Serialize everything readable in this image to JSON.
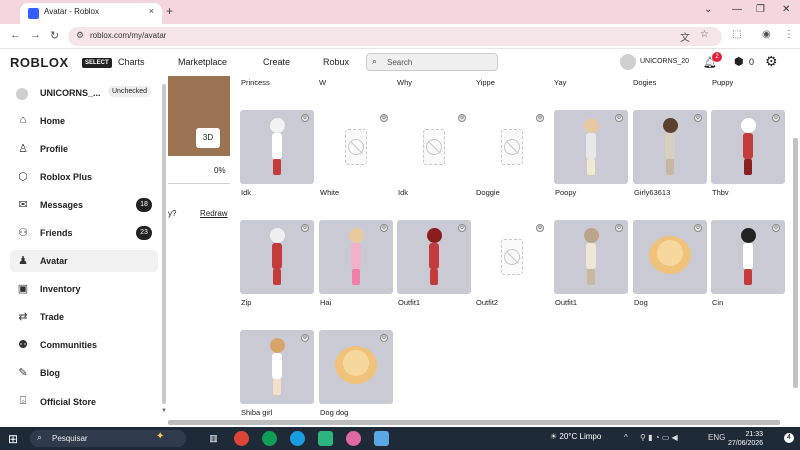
{
  "browser": {
    "tab_title": "Avatar - Roblox",
    "tab_close": "×",
    "new_tab": "+",
    "url": "roblox.com/my/avatar",
    "window_controls": [
      "⌄",
      "—",
      "❐",
      "✕"
    ]
  },
  "header": {
    "logo": "ROBLOX",
    "logo_badge": "SELECT",
    "nav": [
      "Charts",
      "Marketplace",
      "Create",
      "Robux"
    ],
    "search_placeholder": "Search",
    "username": "UNICORNS_20",
    "notification_count": "2",
    "robux_balance": "0"
  },
  "sidebar": {
    "username": "UNICORNS_...",
    "status_tag": "Unchecked",
    "items": [
      {
        "label": "Home",
        "icon": "home-icon",
        "glyph": "⌂"
      },
      {
        "label": "Profile",
        "icon": "profile-icon",
        "glyph": "♙"
      },
      {
        "label": "Roblox Plus",
        "icon": "roblox-plus-icon",
        "glyph": "⬡"
      },
      {
        "label": "Messages",
        "icon": "messages-icon",
        "glyph": "✉",
        "count": "18"
      },
      {
        "label": "Friends",
        "icon": "friends-icon",
        "glyph": "⚇",
        "count": "23"
      },
      {
        "label": "Avatar",
        "icon": "avatar-icon",
        "glyph": "♟",
        "active": true
      },
      {
        "label": "Inventory",
        "icon": "inventory-icon",
        "glyph": "▣"
      },
      {
        "label": "Trade",
        "icon": "trade-icon",
        "glyph": "⇄"
      },
      {
        "label": "Communities",
        "icon": "communities-icon",
        "glyph": "⚉"
      },
      {
        "label": "Blog",
        "icon": "blog-icon",
        "glyph": "✎"
      },
      {
        "label": "Official Store",
        "icon": "store-icon",
        "glyph": "⌺"
      }
    ]
  },
  "preview": {
    "view_3d": "3D",
    "progress_percent": "0%",
    "question_fragment": "y?",
    "redraw": "Redraw"
  },
  "outfits_top_row_labels": [
    "Princess",
    "W",
    "Why",
    "Yippe",
    "Yay",
    "Dogies",
    "Puppy"
  ],
  "outfits": [
    {
      "name": "Idk",
      "kind": "avatar",
      "hat": "#f2f2f2",
      "shirt": "#ffffff",
      "legs": "#c33b3b",
      "hair": "#2a2a2a"
    },
    {
      "name": "White",
      "kind": "empty"
    },
    {
      "name": "Idk",
      "kind": "empty"
    },
    {
      "name": "Doggie",
      "kind": "empty"
    },
    {
      "name": "Poopy",
      "kind": "avatar",
      "hat": "#e6c9a0",
      "shirt": "#e8e8e8",
      "legs": "#f3e8d0",
      "hair": "#d9b98c"
    },
    {
      "name": "Girly63613",
      "kind": "avatar",
      "hat": "#5a4030",
      "shirt": "#d8cfc0",
      "legs": "#c7b8a3",
      "hair": "#4a3020"
    },
    {
      "name": "Thbv",
      "kind": "avatar",
      "hat": "#ffffff",
      "shirt": "#c33b3b",
      "legs": "#8a2020",
      "hair": "#222222"
    },
    {
      "name": "Zip",
      "kind": "avatar",
      "hat": "#f0f0f0",
      "shirt": "#c33b3b",
      "legs": "#c33b3b",
      "hair": "#222222"
    },
    {
      "name": "Hai",
      "kind": "avatar",
      "hat": "#e9c9a0",
      "shirt": "#f3b0c8",
      "legs": "#f07fa8",
      "hair": "#d9a27a"
    },
    {
      "name": "Outfit1",
      "kind": "avatar",
      "hat": "#8a1e1e",
      "shirt": "#c33b3b",
      "legs": "#c33b3b",
      "hair": "#3a2a1a"
    },
    {
      "name": "Outfit2",
      "kind": "empty"
    },
    {
      "name": "Outfit1",
      "kind": "avatar",
      "hat": "#bba58a",
      "shirt": "#efe6d8",
      "legs": "#c9b79f",
      "hair": "#9d8568"
    },
    {
      "name": "Dog",
      "kind": "pet"
    },
    {
      "name": "Cin",
      "kind": "avatar",
      "hat": "#222222",
      "shirt": "#ffffff",
      "legs": "#c33b3b",
      "hair": "#222222"
    },
    {
      "name": "Shiba girl",
      "kind": "avatar",
      "hat": "#d8a46a",
      "shirt": "#ffffff",
      "legs": "#f3e0c8",
      "hair": "#c98d4f"
    },
    {
      "name": "Dog dog",
      "kind": "pet"
    }
  ],
  "taskbar": {
    "search_placeholder": "Pesquisar",
    "weather": "20°C  Limpo",
    "language": "ENG",
    "time": "21:33",
    "date": "27/06/2026",
    "notification_badge": "4"
  }
}
